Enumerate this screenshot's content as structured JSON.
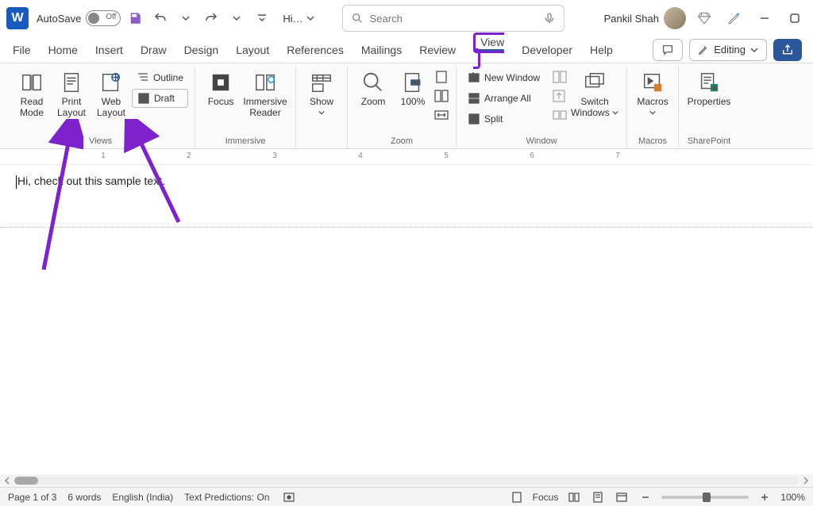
{
  "titlebar": {
    "autosave_label": "AutoSave",
    "autosave_state": "Off",
    "doc_name": "Hi…",
    "search_placeholder": "Search",
    "user_name": "Pankil Shah"
  },
  "tabs": {
    "file": "File",
    "home": "Home",
    "insert": "Insert",
    "draw": "Draw",
    "design": "Design",
    "layout": "Layout",
    "references": "References",
    "mailings": "Mailings",
    "review": "Review",
    "view": "View",
    "developer": "Developer",
    "help": "Help",
    "editing": "Editing"
  },
  "ribbon": {
    "views": {
      "label": "Views",
      "read_mode": "Read Mode",
      "print_layout": "Print Layout",
      "web_layout": "Web Layout",
      "outline": "Outline",
      "draft": "Draft"
    },
    "immersive": {
      "label": "Immersive",
      "focus": "Focus",
      "immersive_reader": "Immersive Reader"
    },
    "show": {
      "label": "Show"
    },
    "zoom": {
      "label": "Zoom",
      "zoom": "Zoom",
      "hundred": "100%"
    },
    "window": {
      "label": "Window",
      "new_window": "New Window",
      "arrange_all": "Arrange All",
      "split": "Split",
      "switch_windows": "Switch Windows"
    },
    "macros": {
      "label": "Macros",
      "macros": "Macros"
    },
    "sharepoint": {
      "label": "SharePoint",
      "properties": "Properties"
    }
  },
  "ruler": {
    "n1": "1",
    "n2": "2",
    "n3": "3",
    "n4": "4",
    "n5": "5",
    "n6": "6",
    "n7": "7"
  },
  "document": {
    "text": "Hi, check out this sample text."
  },
  "status": {
    "page": "Page 1 of 3",
    "words": "6 words",
    "language": "English (India)",
    "predictions": "Text Predictions: On",
    "focus": "Focus",
    "zoom": "100%"
  }
}
